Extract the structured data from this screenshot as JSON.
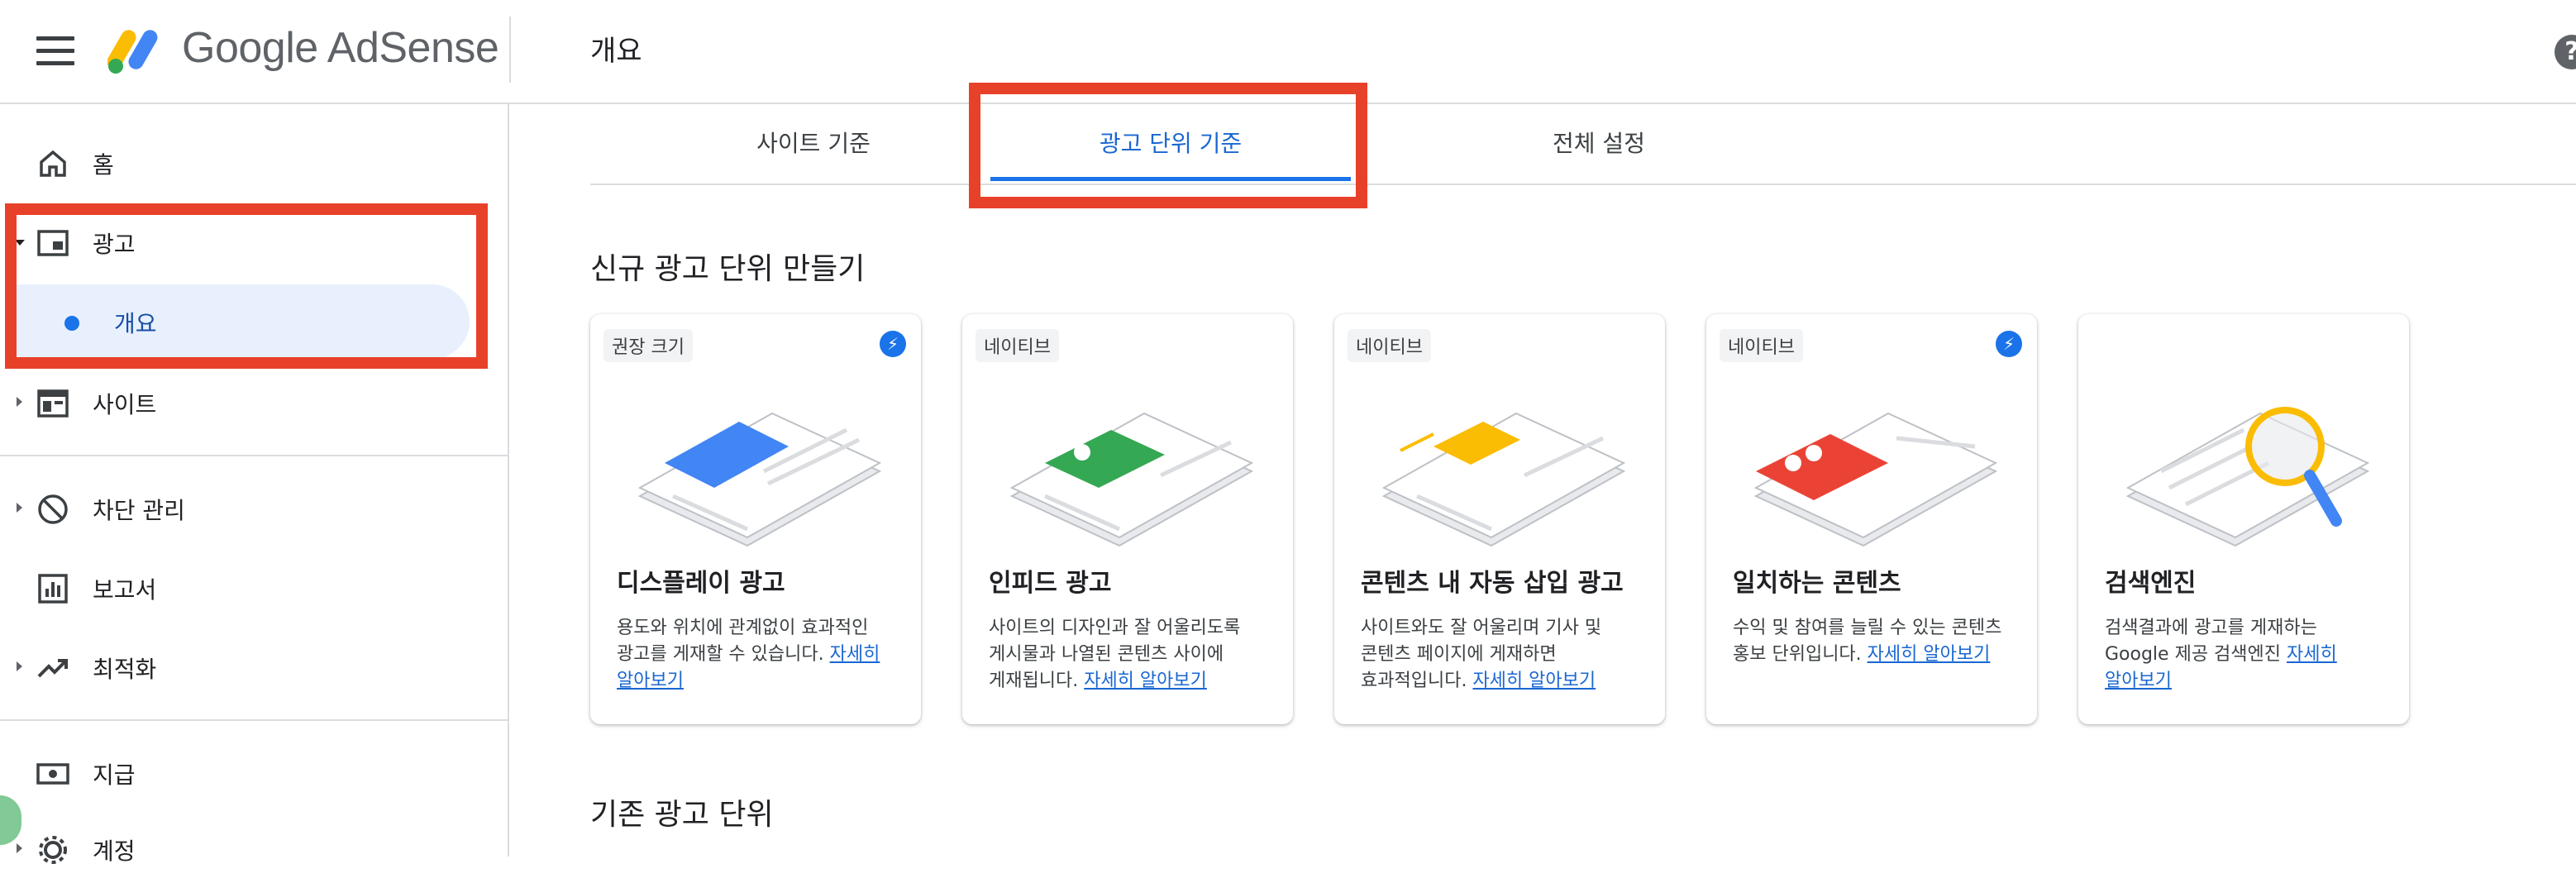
{
  "header": {
    "brand": "Google AdSense",
    "page_title": "개요",
    "help_symbol": "?"
  },
  "sidebar": {
    "items": [
      {
        "label": "홈",
        "icon": "home-icon"
      },
      {
        "label": "광고",
        "icon": "ads-icon",
        "expanded": true
      },
      {
        "label": "개요",
        "selected": true
      },
      {
        "label": "사이트",
        "icon": "sites-icon"
      },
      {
        "label": "차단 관리",
        "icon": "block-icon"
      },
      {
        "label": "보고서",
        "icon": "reports-icon"
      },
      {
        "label": "최적화",
        "icon": "optimization-icon"
      },
      {
        "label": "지급",
        "icon": "payments-icon"
      },
      {
        "label": "계정",
        "icon": "account-icon"
      }
    ]
  },
  "tabs": [
    {
      "label": "사이트 기준"
    },
    {
      "label": "광고 단위 기준",
      "active": true
    },
    {
      "label": "전체 설정"
    }
  ],
  "main": {
    "section_title": "신규 광고 단위 만들기",
    "section2_title": "기존 광고 단위",
    "cards": [
      {
        "badge": "권장 크기",
        "bolt": "⚡",
        "title": "디스플레이 광고",
        "desc": "용도와 위치에 관계없이 효과적인 광고를 게재할 수 있습니다.",
        "link": "자세히 알아보기"
      },
      {
        "badge": "네이티브",
        "title": "인피드 광고",
        "desc": "사이트의 디자인과 잘 어울리도록 게시물과 나열된 콘텐츠 사이에 게재됩니다.",
        "link": "자세히 알아보기"
      },
      {
        "badge": "네이티브",
        "title": "콘텐츠 내 자동 삽입 광고",
        "desc": "사이트와도 잘 어울리며 기사 및 콘텐츠 페이지에 게재하면 효과적입니다.",
        "link": "자세히 알아보기"
      },
      {
        "badge": "네이티브",
        "bolt": "⚡",
        "title": "일치하는 콘텐츠",
        "desc": "수익 및 참여를 늘릴 수 있는 콘텐츠 홍보 단위입니다.",
        "link": "자세히 알아보기"
      },
      {
        "title": "검색엔진",
        "desc": "검색결과에 광고를 게재하는 Google 제공 검색엔진",
        "link": "자세히 알아보기"
      }
    ]
  },
  "colors": {
    "accent": "#1a73e8",
    "highlight_box": "#e8412a",
    "selected_bg": "#e8f0fe"
  }
}
